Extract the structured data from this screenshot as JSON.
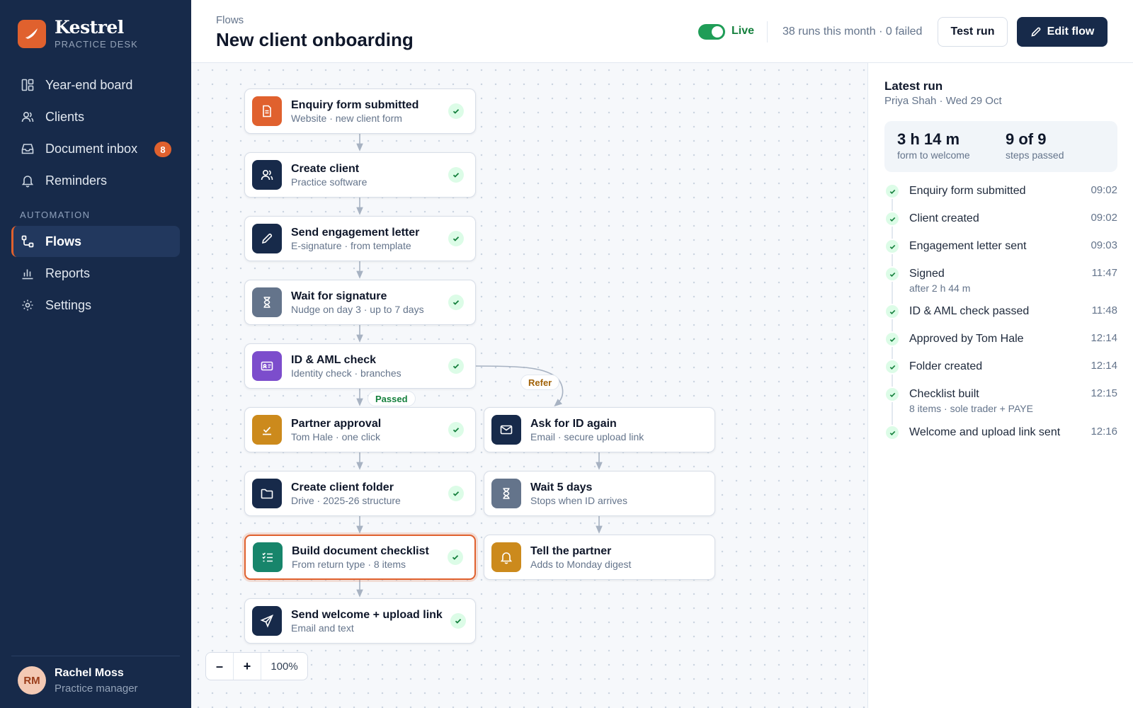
{
  "brand": {
    "name": "Kestrel",
    "subtitle": "PRACTICE DESK"
  },
  "nav": {
    "items": [
      {
        "label": "Year-end board",
        "icon": "board-icon"
      },
      {
        "label": "Clients",
        "icon": "users-icon"
      },
      {
        "label": "Document inbox",
        "icon": "inbox-icon",
        "badge": "8"
      },
      {
        "label": "Reminders",
        "icon": "bell-icon"
      }
    ],
    "section_label": "AUTOMATION",
    "automation_items": [
      {
        "label": "Flows",
        "icon": "flow-icon",
        "active": true
      },
      {
        "label": "Reports",
        "icon": "chart-icon"
      },
      {
        "label": "Settings",
        "icon": "gear-icon"
      }
    ]
  },
  "user": {
    "initials": "RM",
    "name": "Rachel Moss",
    "role": "Practice manager"
  },
  "header": {
    "breadcrumb": "Flows",
    "title": "New client onboarding",
    "live_label": "Live",
    "live_on": true,
    "run_stats": "38 runs this month · 0 failed",
    "test_run_label": "Test run",
    "edit_flow_label": "Edit flow"
  },
  "flow": {
    "main": [
      {
        "title": "Enquiry form submitted",
        "subtitle": "Website · new client form",
        "icon": "document-icon",
        "color": "#e0612e",
        "done": true
      },
      {
        "title": "Create client",
        "subtitle": "Practice software",
        "icon": "users-icon",
        "color": "#172a4a",
        "done": true
      },
      {
        "title": "Send engagement letter",
        "subtitle": "E-signature · from template",
        "icon": "pen-icon",
        "color": "#172a4a",
        "done": true
      },
      {
        "title": "Wait for signature",
        "subtitle": "Nudge on day 3 · up to 7 days",
        "icon": "hourglass-icon",
        "color": "#64748b",
        "done": true
      },
      {
        "title": "ID & AML check",
        "subtitle": "Identity check · branches",
        "icon": "id-card-icon",
        "color": "#7c4dcc",
        "done": true
      },
      {
        "title": "Partner approval",
        "subtitle": "Tom Hale · one click",
        "icon": "approve-icon",
        "color": "#cc8a1c",
        "done": true
      },
      {
        "title": "Create client folder",
        "subtitle": "Drive · 2025-26 structure",
        "icon": "folder-icon",
        "color": "#172a4a",
        "done": true
      },
      {
        "title": "Build document checklist",
        "subtitle": "From return type · 8 items",
        "icon": "checklist-icon",
        "color": "#17856b",
        "done": true,
        "selected": true
      },
      {
        "title": "Send welcome + upload link",
        "subtitle": "Email and text",
        "icon": "send-icon",
        "color": "#172a4a",
        "done": true
      }
    ],
    "branch": [
      {
        "title": "Ask for ID again",
        "subtitle": "Email · secure upload link",
        "icon": "mail-icon",
        "color": "#172a4a"
      },
      {
        "title": "Wait 5 days",
        "subtitle": "Stops when ID arrives",
        "icon": "hourglass-icon",
        "color": "#64748b"
      },
      {
        "title": "Tell the partner",
        "subtitle": "Adds to Monday digest",
        "icon": "bell-icon",
        "color": "#cc8a1c"
      }
    ],
    "passed_label": "Passed",
    "refer_label": "Refer"
  },
  "zoom": {
    "minus": "–",
    "plus": "+",
    "level": "100%"
  },
  "latest_run": {
    "title": "Latest run",
    "subtitle": "Priya Shah · Wed 29 Oct",
    "duration": "3 h 14 m",
    "duration_label": "form to welcome",
    "steps": "9 of 9",
    "steps_label": "steps passed",
    "events": [
      {
        "label": "Enquiry form submitted",
        "time": "09:02"
      },
      {
        "label": "Client created",
        "time": "09:02"
      },
      {
        "label": "Engagement letter sent",
        "time": "09:03"
      },
      {
        "label": "Signed",
        "sub": "after 2 h 44 m",
        "time": "11:47"
      },
      {
        "label": "ID & AML check passed",
        "time": "11:48"
      },
      {
        "label": "Approved by Tom Hale",
        "time": "12:14"
      },
      {
        "label": "Folder created",
        "time": "12:14"
      },
      {
        "label": "Checklist built",
        "sub": "8 items · sole trader + PAYE",
        "time": "12:15"
      },
      {
        "label": "Welcome and upload link sent",
        "time": "12:16"
      }
    ]
  },
  "colors": {
    "accent": "#e0612e",
    "navy": "#172a4a",
    "success": "#15803d"
  }
}
